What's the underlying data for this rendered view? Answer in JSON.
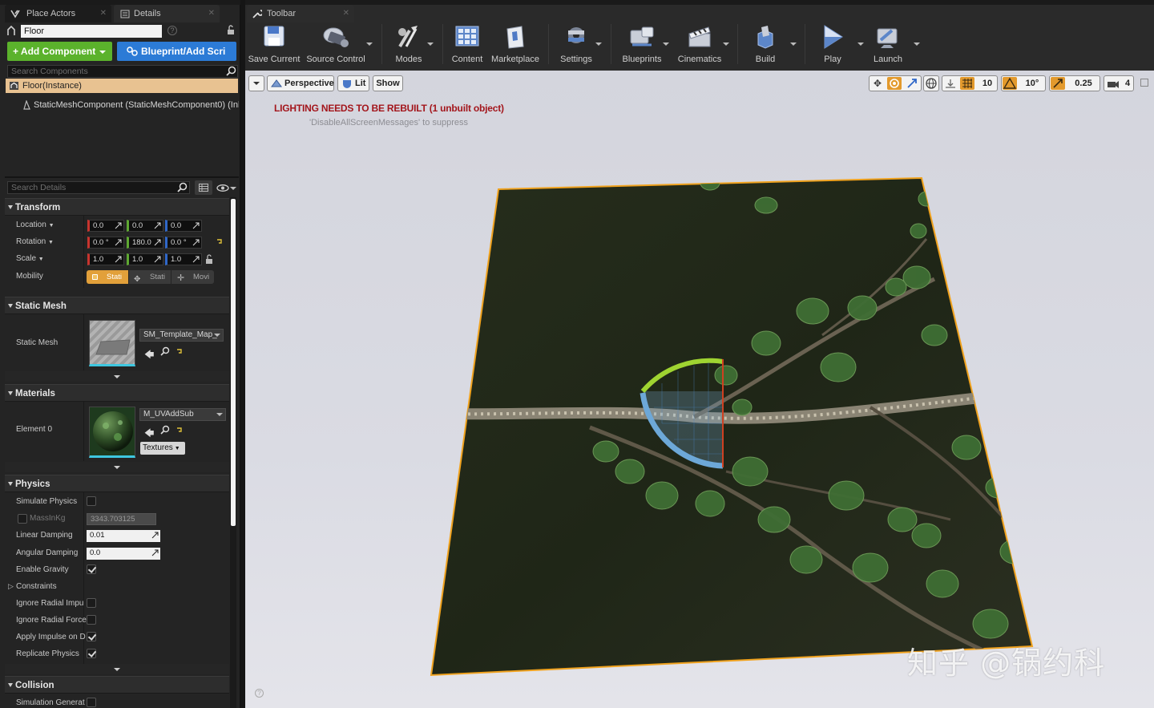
{
  "tabs": {
    "place_actors": "Place Actors",
    "details": "Details",
    "toolbar": "Toolbar"
  },
  "details": {
    "actor_name": "Floor",
    "add_component": "+ Add Component",
    "blueprint_btn": "Blueprint/Add Scri",
    "search_components_placeholder": "Search Components",
    "tree": {
      "root": "Floor(Instance)",
      "child": "StaticMeshComponent (StaticMeshComponent0) (Inh"
    },
    "search_details_placeholder": "Search Details"
  },
  "transform": {
    "title": "Transform",
    "location_label": "Location",
    "rotation_label": "Rotation",
    "scale_label": "Scale",
    "mobility_label": "Mobility",
    "location": [
      "0.0",
      "0.0",
      "0.0"
    ],
    "rotation": [
      "0.0 °",
      "180.0",
      "0.0 °"
    ],
    "scale": [
      "1.0",
      "1.0",
      "1.0"
    ],
    "mobility": [
      "Stati",
      "Stati",
      "Movi"
    ]
  },
  "static_mesh": {
    "title": "Static Mesh",
    "label": "Static Mesh",
    "value": "SM_Template_Map_"
  },
  "materials": {
    "title": "Materials",
    "label": "Element 0",
    "value": "M_UVAddSub",
    "textures_btn": "Textures"
  },
  "physics": {
    "title": "Physics",
    "simulate_physics": "Simulate Physics",
    "mass": "MassInKg",
    "mass_value": "3343.703125",
    "linear_damping": "Linear Damping",
    "linear_damping_value": "0.01",
    "angular_damping": "Angular Damping",
    "angular_damping_value": "0.0",
    "enable_gravity": "Enable Gravity",
    "constraints": "Constraints",
    "ignore_radial_impulse": "Ignore Radial Impu",
    "ignore_radial_force": "Ignore Radial Force",
    "apply_impulse": "Apply Impulse on D",
    "replicate_physics": "Replicate Physics",
    "checks": {
      "simulate_physics": false,
      "mass": false,
      "enable_gravity": true,
      "ignore_radial_impulse": false,
      "ignore_radial_force": false,
      "apply_impulse": true,
      "replicate_physics": true
    }
  },
  "collision": {
    "title": "Collision",
    "simulation_generates": "Simulation Generat"
  },
  "toolbar": {
    "save_current": "Save Current",
    "source_control": "Source Control",
    "modes": "Modes",
    "content": "Content",
    "marketplace": "Marketplace",
    "settings": "Settings",
    "blueprints": "Blueprints",
    "cinematics": "Cinematics",
    "build": "Build",
    "play": "Play",
    "launch": "Launch"
  },
  "viewport": {
    "perspective": "Perspective",
    "lit": "Lit",
    "show": "Show",
    "grid_snap": "10",
    "rot_snap": "10°",
    "scale_snap": "0.25",
    "camera_speed": "4",
    "warning": "LIGHTING NEEDS TO BE REBUILT (1 unbuilt object)",
    "suppress": "'DisableAllScreenMessages' to suppress",
    "watermark": "知乎 @锅约科"
  },
  "colors": {
    "accent_green": "#5bb22c",
    "accent_blue": "#2c7bd6",
    "warning_red": "#a3161c",
    "selection_orange": "#f0a21e"
  }
}
